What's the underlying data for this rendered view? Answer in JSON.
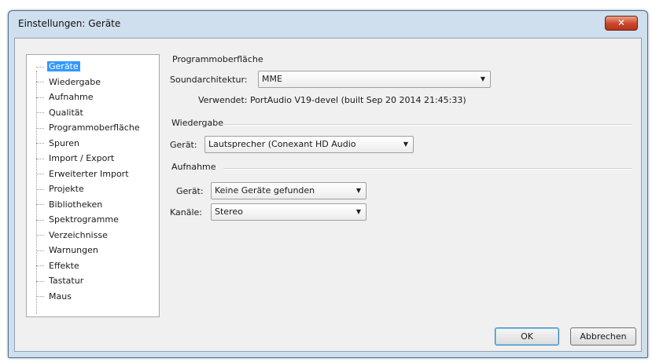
{
  "window": {
    "title": "Einstellungen: Geräte",
    "close_symbol": "✕"
  },
  "tree": {
    "items": [
      "Geräte",
      "Wiedergabe",
      "Aufnahme",
      "Qualität",
      "Programmoberfläche",
      "Spuren",
      "Import / Export",
      "Erweiterter Import",
      "Projekte",
      "Bibliotheken",
      "Spektrogramme",
      "Verzeichnisse",
      "Warnungen",
      "Effekte",
      "Tastatur",
      "Maus"
    ],
    "selected": "Geräte"
  },
  "interface": {
    "title": "Programmoberfläche",
    "host_label": "Soundarchitektur:",
    "host_value": "MME",
    "using_text": "Verwendet: PortAudio V19-devel (built Sep 20 2014 21:45:33)"
  },
  "playback": {
    "title": "Wiedergabe",
    "device_label": "Gerät:",
    "device_value": "Lautsprecher (Conexant HD Audio"
  },
  "recording": {
    "title": "Aufnahme",
    "device_label": "Gerät:",
    "device_value": "Keine Geräte gefunden",
    "channels_label": "Kanäle:",
    "channels_value": "Stereo"
  },
  "buttons": {
    "ok": "OK",
    "cancel": "Abbrechen"
  },
  "icons": {
    "dropdown": "chevron-down-icon",
    "close": "close-icon"
  }
}
